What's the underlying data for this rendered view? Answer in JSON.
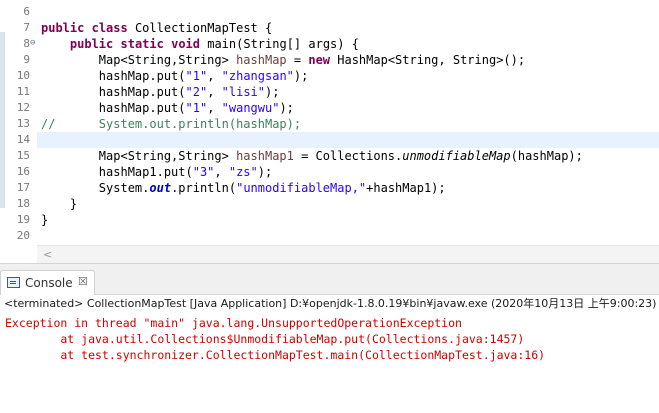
{
  "editor": {
    "lines": [
      {
        "no": "6",
        "text": ""
      },
      {
        "no": "7",
        "text": "public class CollectionMapTest {"
      },
      {
        "no": "8",
        "text": "    public static void main(String[] args) {"
      },
      {
        "no": "9",
        "text": "        Map<String,String> hashMap = new HashMap<String, String>();"
      },
      {
        "no": "10",
        "text": "        hashMap.put(\"1\", \"zhangsan\");"
      },
      {
        "no": "11",
        "text": "        hashMap.put(\"2\", \"lisi\");"
      },
      {
        "no": "12",
        "text": "        hashMap.put(\"1\", \"wangwu\");"
      },
      {
        "no": "13",
        "text": "//      System.out.println(hashMap);"
      },
      {
        "no": "14",
        "text": ""
      },
      {
        "no": "15",
        "text": "        Map<String,String> hashMap1 = Collections.unmodifiableMap(hashMap);"
      },
      {
        "no": "16",
        "text": "        hashMap1.put(\"3\", \"zs\");"
      },
      {
        "no": "17",
        "text": "        System.out.println(\"unmodifiableMap,\"+hashMap1);"
      },
      {
        "no": "18",
        "text": "    }"
      },
      {
        "no": "19",
        "text": "}"
      },
      {
        "no": "20",
        "text": ""
      }
    ],
    "fold_marker": "⊖",
    "scroll_left": "<"
  },
  "console": {
    "tab_label": "Console",
    "close_glyph": "☒",
    "status": "<terminated> CollectionMapTest [Java Application] D:¥openjdk-1.8.0.19¥bin¥javaw.exe (2020年10月13日 上午9:00:23)",
    "output": [
      "Exception in thread \"main\" java.lang.UnsupportedOperationException",
      "\tat java.util.Collections$UnmodifiableMap.put(Collections.java:1457)",
      "\tat test.synchronizer.CollectionMapTest.main(CollectionMapTest.java:16)"
    ]
  },
  "colors": {
    "keyword": "#7f0055",
    "string": "#2a00ff",
    "comment": "#3f7f5f",
    "error": "#d00000"
  }
}
